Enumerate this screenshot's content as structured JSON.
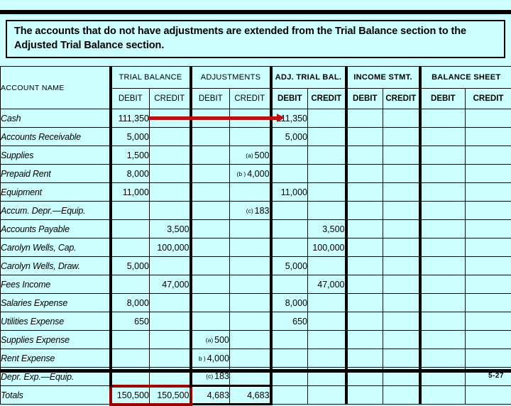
{
  "callout": {
    "text": "The accounts that do not have adjustments are extended from the Trial Balance section to the Adjusted Trial Balance section."
  },
  "worksheet": {
    "account_column_header": "ACCOUNT NAME",
    "groups": [
      {
        "label": "TRIAL BALANCE",
        "sub": [
          "DEBIT",
          "CREDIT"
        ]
      },
      {
        "label": "ADJUSTMENTS",
        "sub": [
          "DEBIT",
          "CREDIT"
        ]
      },
      {
        "label": "ADJ. TRIAL BAL.",
        "sub": [
          "DEBIT",
          "CREDIT"
        ]
      },
      {
        "label": "INCOME STMT.",
        "sub": [
          "DEBIT",
          "CREDIT"
        ]
      },
      {
        "label": "BALANCE SHEET",
        "sub": [
          "DEBIT",
          "CREDIT"
        ]
      }
    ],
    "rows": [
      {
        "account": "Cash",
        "tb_debit": "111,350",
        "tb_credit": "",
        "adj_debit": "",
        "adj_credit": "",
        "atb_debit": "111,350",
        "atb_credit": "",
        "is_debit": "",
        "is_credit": "",
        "bs_debit": "",
        "bs_credit": ""
      },
      {
        "account": "Accounts Receivable",
        "tb_debit": "5,000",
        "tb_credit": "",
        "adj_debit": "",
        "adj_credit": "",
        "atb_debit": "5,000",
        "atb_credit": "",
        "is_debit": "",
        "is_credit": "",
        "bs_debit": "",
        "bs_credit": ""
      },
      {
        "account": "Supplies",
        "tb_debit": "1,500",
        "tb_credit": "",
        "adj_debit": "",
        "adj_credit": "500",
        "adj_credit_tag": "(a)",
        "atb_debit": "",
        "atb_credit": "",
        "is_debit": "",
        "is_credit": "",
        "bs_debit": "",
        "bs_credit": ""
      },
      {
        "account": "Prepaid Rent",
        "tb_debit": "8,000",
        "tb_credit": "",
        "adj_debit": "",
        "adj_credit": "4,000",
        "adj_credit_tag": "(b )",
        "atb_debit": "",
        "atb_credit": "",
        "is_debit": "",
        "is_credit": "",
        "bs_debit": "",
        "bs_credit": ""
      },
      {
        "account": "Equipment",
        "tb_debit": "11,000",
        "tb_credit": "",
        "adj_debit": "",
        "adj_credit": "",
        "atb_debit": "11,000",
        "atb_credit": "",
        "is_debit": "",
        "is_credit": "",
        "bs_debit": "",
        "bs_credit": ""
      },
      {
        "account": "Accum. Depr.—Equip.",
        "tb_debit": "",
        "tb_credit": "",
        "adj_debit": "",
        "adj_credit": "183",
        "adj_credit_tag": "(c)",
        "atb_debit": "",
        "atb_credit": "",
        "is_debit": "",
        "is_credit": "",
        "bs_debit": "",
        "bs_credit": ""
      },
      {
        "account": "Accounts Payable",
        "tb_debit": "",
        "tb_credit": "3,500",
        "adj_debit": "",
        "adj_credit": "",
        "atb_debit": "",
        "atb_credit": "3,500",
        "is_debit": "",
        "is_credit": "",
        "bs_debit": "",
        "bs_credit": ""
      },
      {
        "account": "Carolyn Wells, Cap.",
        "tb_debit": "",
        "tb_credit": "100,000",
        "adj_debit": "",
        "adj_credit": "",
        "atb_debit": "",
        "atb_credit": "100,000",
        "is_debit": "",
        "is_credit": "",
        "bs_debit": "",
        "bs_credit": ""
      },
      {
        "account": "Carolyn Wells, Draw.",
        "tb_debit": "5,000",
        "tb_credit": "",
        "adj_debit": "",
        "adj_credit": "",
        "atb_debit": "5,000",
        "atb_credit": "",
        "is_debit": "",
        "is_credit": "",
        "bs_debit": "",
        "bs_credit": ""
      },
      {
        "account": "Fees Income",
        "tb_debit": "",
        "tb_credit": "47,000",
        "adj_debit": "",
        "adj_credit": "",
        "atb_debit": "",
        "atb_credit": "47,000",
        "is_debit": "",
        "is_credit": "",
        "bs_debit": "",
        "bs_credit": ""
      },
      {
        "account": "Salaries Expense",
        "tb_debit": "8,000",
        "tb_credit": "",
        "adj_debit": "",
        "adj_credit": "",
        "atb_debit": "8,000",
        "atb_credit": "",
        "is_debit": "",
        "is_credit": "",
        "bs_debit": "",
        "bs_credit": ""
      },
      {
        "account": "Utilities Expense",
        "tb_debit": "650",
        "tb_credit": "",
        "adj_debit": "",
        "adj_credit": "",
        "atb_debit": "650",
        "atb_credit": "",
        "is_debit": "",
        "is_credit": "",
        "bs_debit": "",
        "bs_credit": ""
      },
      {
        "account": "Supplies Expense",
        "tb_debit": "",
        "tb_credit": "",
        "adj_debit": "500",
        "adj_debit_tag": "(a)",
        "adj_credit": "",
        "atb_debit": "",
        "atb_credit": "",
        "is_debit": "",
        "is_credit": "",
        "bs_debit": "",
        "bs_credit": ""
      },
      {
        "account": "Rent Expense",
        "tb_debit": "",
        "tb_credit": "",
        "adj_debit": "4,000",
        "adj_debit_tag": "b )",
        "adj_credit": "",
        "atb_debit": "",
        "atb_credit": "",
        "is_debit": "",
        "is_credit": "",
        "bs_debit": "",
        "bs_credit": ""
      },
      {
        "account": "Depr. Exp.—Equip.",
        "tb_debit": "",
        "tb_credit": "",
        "adj_debit": "183",
        "adj_debit_tag": "(c)",
        "adj_credit": "",
        "atb_debit": "",
        "atb_credit": "",
        "is_debit": "",
        "is_credit": "",
        "bs_debit": "",
        "bs_credit": ""
      }
    ],
    "totals": {
      "account": "Totals",
      "tb_debit": "150,500",
      "tb_credit": "150,500",
      "adj_debit": "4,683",
      "adj_credit": "4,683",
      "atb_debit": "",
      "atb_credit": "",
      "is_debit": "",
      "is_credit": "",
      "bs_debit": "",
      "bs_credit": ""
    }
  },
  "slide_number": "5-27",
  "colors": {
    "background": "#ccffff",
    "arrow": "#bb1111",
    "rule": "#000000",
    "total_rule_red": "#990000"
  }
}
